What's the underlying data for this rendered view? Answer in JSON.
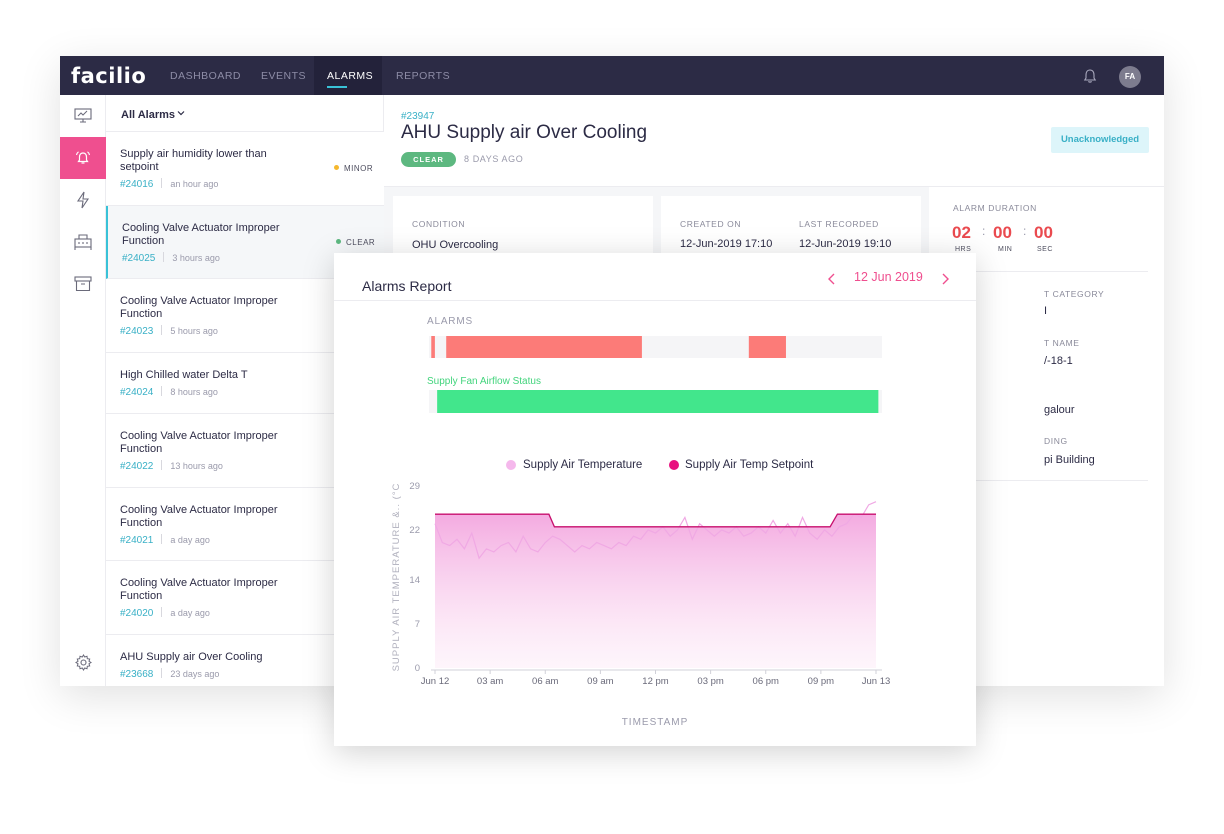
{
  "app": {
    "logo": "facilio",
    "nav": [
      "DASHBOARD",
      "EVENTS",
      "ALARMS",
      "REPORTS"
    ],
    "active_nav": "ALARMS",
    "avatar": "FA"
  },
  "list": {
    "title": "All Alarms",
    "items": [
      {
        "title": "Supply air humidity lower than setpoint",
        "id": "#24016",
        "time": "an hour ago",
        "severity": "MINOR",
        "severity_color": "#f5b82e"
      },
      {
        "title": "Cooling Valve Actuator Improper Function",
        "id": "#24025",
        "time": "3 hours ago",
        "severity": "CLEAR",
        "severity_color": "#5db880"
      },
      {
        "title": "Cooling Valve Actuator Improper Function",
        "id": "#24023",
        "time": "5 hours ago",
        "severity": "",
        "severity_color": ""
      },
      {
        "title": "High Chilled water Delta T",
        "id": "#24024",
        "time": "8 hours ago",
        "severity": "",
        "severity_color": ""
      },
      {
        "title": "Cooling Valve Actuator Improper Function",
        "id": "#24022",
        "time": "13 hours ago",
        "severity": "",
        "severity_color": ""
      },
      {
        "title": "Cooling Valve Actuator Improper Function",
        "id": "#24021",
        "time": "a day ago",
        "severity": "",
        "severity_color": ""
      },
      {
        "title": "Cooling Valve Actuator Improper Function",
        "id": "#24020",
        "time": "a day ago",
        "severity": "",
        "severity_color": ""
      },
      {
        "title": "AHU Supply air Over Cooling",
        "id": "#23668",
        "time": "23 days ago",
        "severity": "",
        "severity_color": ""
      }
    ]
  },
  "detail": {
    "id": "#23947",
    "title": "AHU Supply air Over Cooling",
    "status": "CLEAR",
    "ago": "8 DAYS AGO",
    "ack": "Unacknowledged",
    "condition_label": "CONDITION",
    "condition_value": "OHU Overcooling",
    "created_label": "CREATED ON",
    "created_value": "12-Jun-2019 17:10",
    "last_label": "LAST RECORDED",
    "last_value": "12-Jun-2019 19:10",
    "duration_label": "ALARM DURATION",
    "duration": {
      "hrs": "02",
      "min": "00",
      "sec": "00",
      "hrs_label": "HRS",
      "min_label": "MIN",
      "sec_label": "SEC"
    },
    "partial": {
      "category_label": "T CATEGORY",
      "category_value": "I",
      "asset_label": "T NAME",
      "asset_value": "/-18-1",
      "location_value": "galour",
      "building_label": "DING",
      "building_value": "pi Building"
    }
  },
  "report": {
    "title": "Alarms Report",
    "date": "12 Jun 2019",
    "alarms_label": "ALARMS",
    "fan_label": "Supply Fan Airflow Status",
    "alarm_color": "#fc7b78",
    "fan_color": "#42e68c",
    "alarm_segments": [
      [
        0.005,
        0.013
      ],
      [
        0.038,
        0.47
      ],
      [
        0.706,
        0.788
      ]
    ],
    "fan_segments": [
      [
        0.018,
        0.992
      ]
    ]
  },
  "chart_data": {
    "type": "area",
    "legend": [
      {
        "name": "Supply Air Temperature",
        "color": "#f5b8ec"
      },
      {
        "name": "Supply Air Temp Setpoint",
        "color": "#e8117f"
      }
    ],
    "ylabel": "SUPPLY AIR TEMPERATURE &.. (°C",
    "xlabel": "TIMESTAMP",
    "yticks": [
      0,
      7,
      14,
      22,
      29
    ],
    "ylim": [
      0,
      29
    ],
    "xticks": [
      "Jun 12",
      "03 am",
      "06 am",
      "09 am",
      "12 pm",
      "03 pm",
      "06 pm",
      "09 pm",
      "Jun 13"
    ],
    "xlim": [
      0,
      24
    ],
    "series": [
      {
        "name": "Supply Air Temp Setpoint",
        "x": [
          0,
          6.2,
          6.5,
          21.5,
          21.9,
          24
        ],
        "y": [
          24.5,
          24.5,
          22.5,
          22.5,
          24.5,
          24.5
        ]
      },
      {
        "name": "Supply Air Temperature",
        "x": [
          0,
          0.4,
          0.8,
          1.2,
          1.6,
          2.0,
          2.4,
          2.8,
          3.2,
          3.6,
          4.0,
          4.4,
          4.8,
          5.2,
          5.6,
          6.0,
          6.4,
          6.8,
          7.2,
          7.6,
          8.0,
          8.4,
          8.8,
          9.2,
          9.6,
          10.0,
          10.4,
          10.8,
          11.2,
          11.6,
          12.0,
          12.4,
          12.8,
          13.2,
          13.6,
          14.0,
          14.4,
          14.8,
          15.2,
          15.6,
          16.0,
          16.4,
          16.8,
          17.2,
          17.6,
          18.0,
          18.4,
          18.8,
          19.2,
          19.6,
          20.0,
          20.4,
          20.8,
          21.2,
          21.6,
          22.0,
          22.4,
          22.8,
          23.2,
          23.6,
          24.0
        ],
        "y": [
          23,
          20,
          19.5,
          20.5,
          19,
          21.5,
          17.5,
          19,
          18.5,
          19.5,
          20,
          18.5,
          21,
          19,
          18.5,
          20,
          21,
          20.5,
          19.5,
          18.5,
          19.5,
          19,
          20,
          19.5,
          19,
          20,
          19.5,
          21,
          20.5,
          22,
          21.5,
          22.5,
          21,
          22,
          24,
          20.5,
          23,
          22,
          21,
          22,
          21.5,
          22.5,
          21,
          21.5,
          22.5,
          21.5,
          23.5,
          21.5,
          23,
          21,
          24,
          21.5,
          20.5,
          22,
          21,
          22.5,
          23,
          24.5,
          24,
          26,
          26.5
        ]
      }
    ]
  }
}
